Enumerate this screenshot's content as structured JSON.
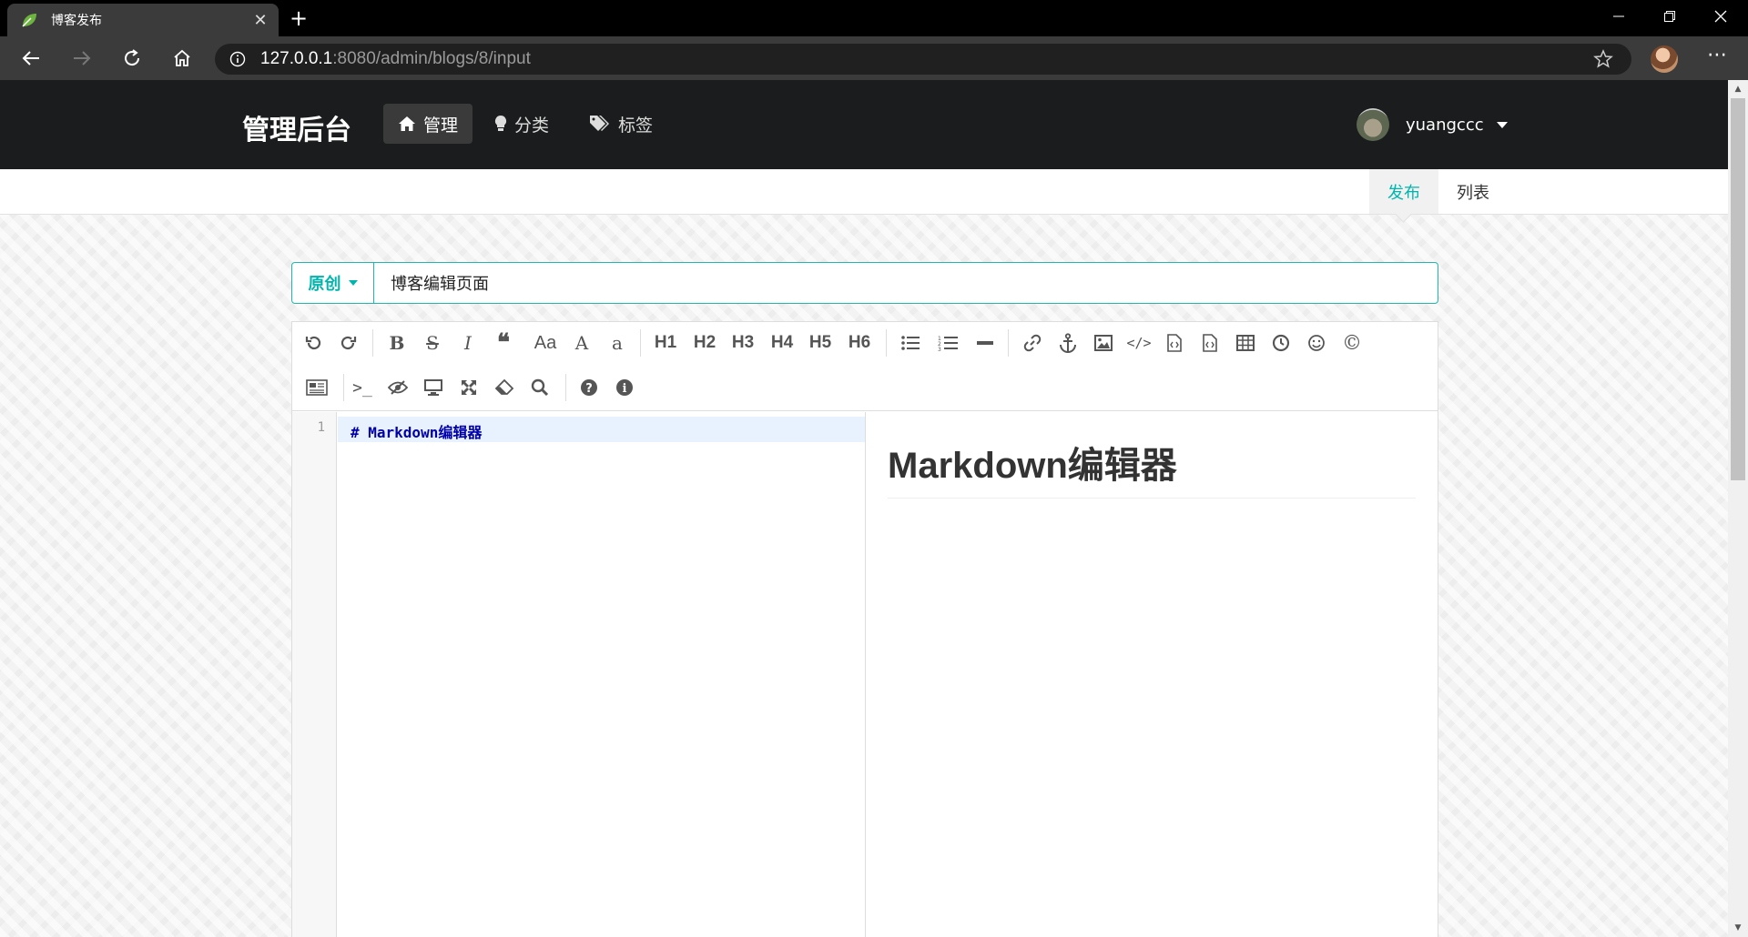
{
  "browser": {
    "tab_title": "博客发布",
    "url_host": "127.0.0.1",
    "url_rest": ":8080/admin/blogs/8/input"
  },
  "app": {
    "brand": "管理后台",
    "nav": [
      {
        "label": "管理",
        "icon": "home-icon"
      },
      {
        "label": "分类",
        "icon": "idea-icon"
      },
      {
        "label": "标签",
        "icon": "tags-icon"
      }
    ],
    "username": "yuangccc"
  },
  "subnav": {
    "publish_label": "发布",
    "list_label": "列表"
  },
  "form": {
    "flag_value": "原创",
    "title_value": "博客编辑页面"
  },
  "toolbar": {
    "row1": [
      "undo-icon",
      "redo-icon",
      "bold-icon",
      "strikethrough-icon",
      "italic-icon",
      "quote-icon",
      "ucwords-icon",
      "uppercase-icon",
      "lowercase-icon",
      "h1",
      "h2",
      "h3",
      "h4",
      "h5",
      "h6",
      "list-ul-icon",
      "list-ol-icon",
      "hr-icon",
      "link-icon",
      "reference-link-icon",
      "image-icon",
      "code-icon",
      "preformatted-text-icon",
      "code-block-icon",
      "table-icon",
      "datetime-icon",
      "emoji-icon",
      "html-entities-icon"
    ],
    "row2": [
      "pagebreak-icon",
      "goto-line-icon",
      "watch-icon",
      "preview-icon",
      "fullscreen-icon",
      "clear-icon",
      "search-icon",
      "help-icon",
      "info-icon"
    ],
    "h_labels": [
      "H1",
      "H2",
      "H3",
      "H4",
      "H5",
      "H6"
    ]
  },
  "editor": {
    "line_number": "1",
    "code_line": "# Markdown编辑器",
    "preview_heading": "Markdown编辑器"
  },
  "colors": {
    "accent": "#00b5ad",
    "nav_bg": "#1b1c1d",
    "code_header": "#0000aa"
  }
}
